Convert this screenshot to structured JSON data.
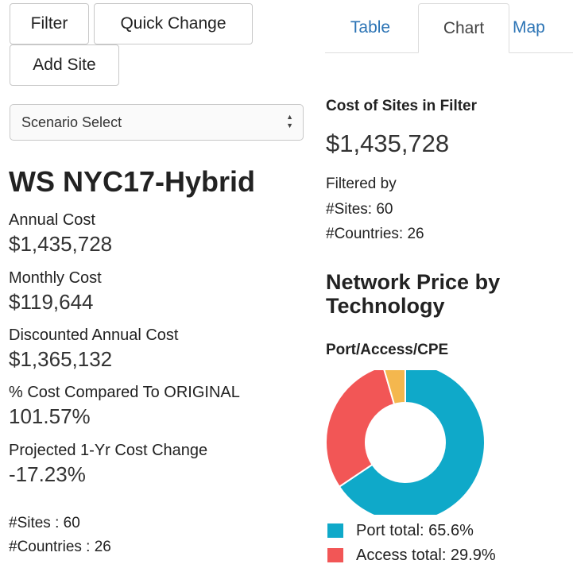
{
  "toolbar": {
    "filter_label": "Filter",
    "quick_change_label": "Quick Change",
    "add_site_label": "Add Site"
  },
  "scenario_select": {
    "selected": "Scenario Select"
  },
  "scenario": {
    "title": "WS NYC17-Hybrid",
    "stats": [
      {
        "label": "Annual Cost",
        "value": "$1,435,728"
      },
      {
        "label": "Monthly Cost",
        "value": "$119,644"
      },
      {
        "label": "Discounted Annual Cost",
        "value": "$1,365,132"
      },
      {
        "label": "% Cost Compared To ORIGINAL",
        "value": "101.57%"
      },
      {
        "label": "Projected 1-Yr Cost Change",
        "value": "-17.23%"
      }
    ],
    "sites_line": "#Sites : 60",
    "countries_line": "#Countries : 26"
  },
  "tabs": [
    {
      "label": "Table",
      "active": false
    },
    {
      "label": "Chart",
      "active": true
    },
    {
      "label": "Map",
      "active": false
    }
  ],
  "panel": {
    "cost_heading": "Cost of Sites in Filter",
    "cost_value": "$1,435,728",
    "filtered_by": "Filtered by",
    "sites": "#Sites: 60",
    "countries": "#Countries: 26",
    "chart_title": "Network Price by Technology",
    "chart_subtitle": "Port/Access/CPE"
  },
  "chart_data": {
    "type": "pie",
    "title": "Port/Access/CPE",
    "donut": true,
    "series": [
      {
        "name": "Port total",
        "value": 65.6,
        "color": "#0fa9c9"
      },
      {
        "name": "Access total",
        "value": 29.9,
        "color": "#f25656"
      },
      {
        "name": "",
        "value": 4.5,
        "color": "#f4b74e"
      }
    ],
    "legend": [
      {
        "label": "Port total: 65.6%",
        "color": "#0fa9c9"
      },
      {
        "label": "Access total: 29.9%",
        "color": "#f25656"
      }
    ]
  }
}
